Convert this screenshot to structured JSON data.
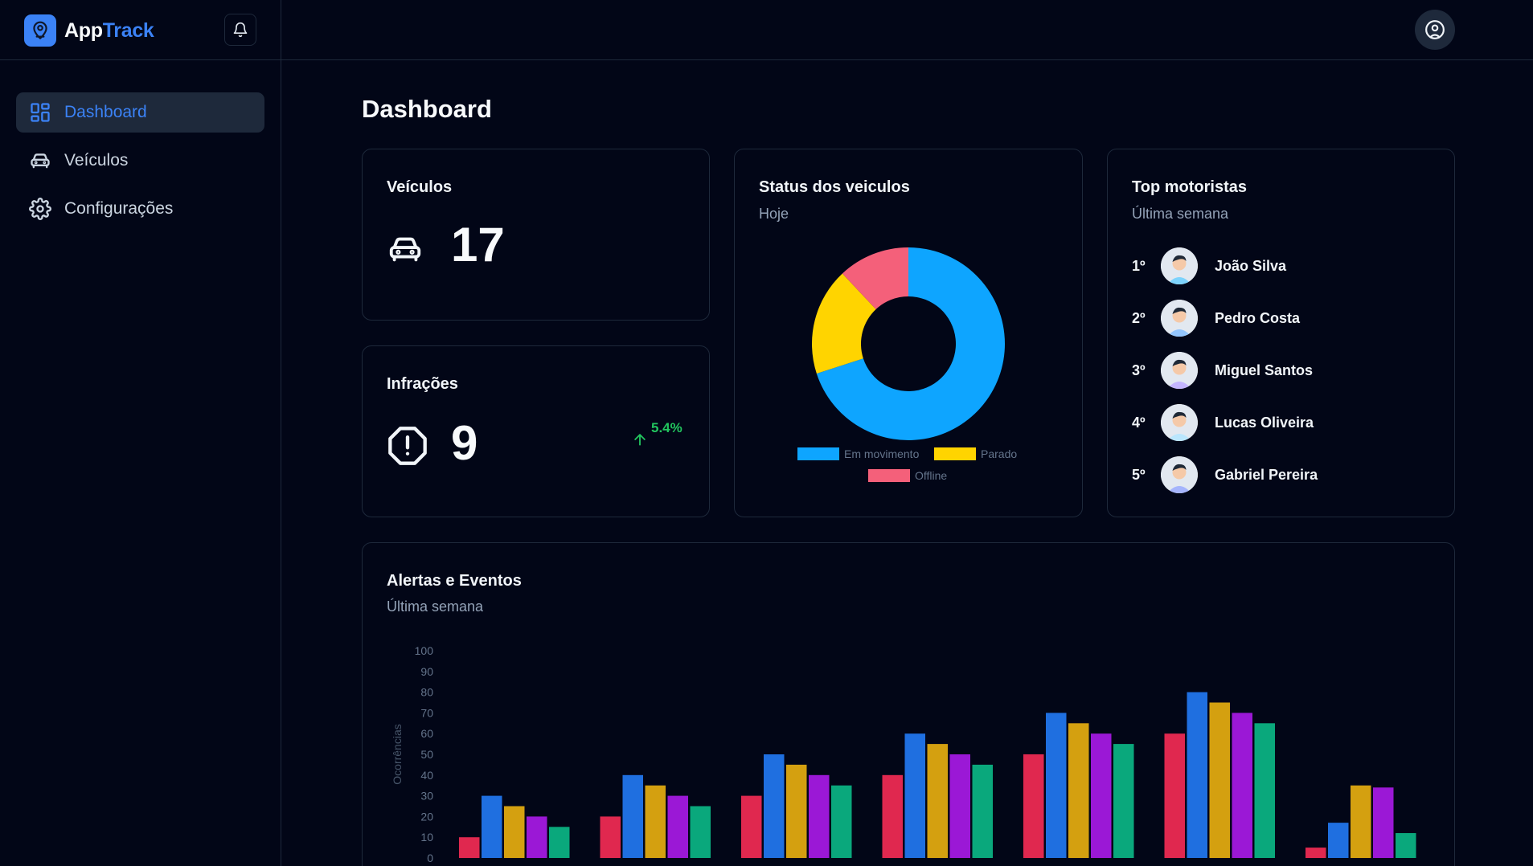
{
  "app": {
    "name_part1": "App",
    "name_part2": "Track"
  },
  "icons": {
    "brand": "map-pin-user-icon",
    "bell": "bell-icon",
    "user": "user-circle-icon",
    "dashboard": "layout-grid-icon",
    "vehicles": "car-icon",
    "settings": "gear-icon",
    "car": "car-icon",
    "alert": "alert-octagon-icon",
    "trend": "arrow-up-icon"
  },
  "sidebar": {
    "items": [
      {
        "label": "Dashboard",
        "active": true
      },
      {
        "label": "Veículos",
        "active": false
      },
      {
        "label": "Configurações",
        "active": false
      }
    ]
  },
  "page": {
    "title": "Dashboard"
  },
  "vehicles_card": {
    "title": "Veículos",
    "value": "17"
  },
  "infractions_card": {
    "title": "Infrações",
    "value": "9",
    "trend": "5.4%"
  },
  "status_card": {
    "title": "Status dos veiculos",
    "subtitle": "Hoje"
  },
  "top_drivers": {
    "title": "Top motoristas",
    "subtitle": "Última semana",
    "drivers": [
      {
        "rank": "1º",
        "name": "João Silva"
      },
      {
        "rank": "2º",
        "name": "Pedro Costa"
      },
      {
        "rank": "3º",
        "name": "Miguel Santos"
      },
      {
        "rank": "4º",
        "name": "Lucas Oliveira"
      },
      {
        "rank": "5º",
        "name": "Gabriel Pereira"
      }
    ]
  },
  "alerts_card": {
    "title": "Alertas e Eventos",
    "subtitle": "Última semana"
  },
  "colors": {
    "accent": "#3b82f6",
    "positive": "#22c55e",
    "moving": "#0ea5ff",
    "stopped": "#ffd400",
    "offline": "#f4607a",
    "bar_colors": [
      "#e0284f",
      "#1f6fe0",
      "#d4a010",
      "#9b18d6",
      "#0aa87c"
    ]
  },
  "chart_data": [
    {
      "type": "pie",
      "style": "donut",
      "labels": [
        "Em movimento",
        "Parado",
        "Offline"
      ],
      "values": [
        70,
        18,
        12
      ],
      "colors": [
        "#0ea5ff",
        "#ffd400",
        "#f4607a"
      ],
      "legend": "bottom"
    },
    {
      "type": "bar",
      "ylabel": "Ocorrências",
      "ylim": [
        0,
        100
      ],
      "yticks": [
        0,
        10,
        20,
        30,
        40,
        50,
        60,
        70,
        80,
        90,
        100
      ],
      "categories": [
        "",
        "",
        "",
        "",
        "",
        "",
        ""
      ],
      "series": [
        {
          "values": [
            10,
            20,
            30,
            40,
            50,
            60,
            5
          ]
        },
        {
          "values": [
            30,
            40,
            50,
            60,
            70,
            80,
            17
          ]
        },
        {
          "values": [
            25,
            35,
            45,
            55,
            65,
            75,
            35
          ]
        },
        {
          "values": [
            20,
            30,
            40,
            50,
            60,
            70,
            34
          ]
        },
        {
          "values": [
            15,
            25,
            35,
            45,
            55,
            65,
            12
          ]
        }
      ],
      "grid": false,
      "legend": "none"
    }
  ]
}
